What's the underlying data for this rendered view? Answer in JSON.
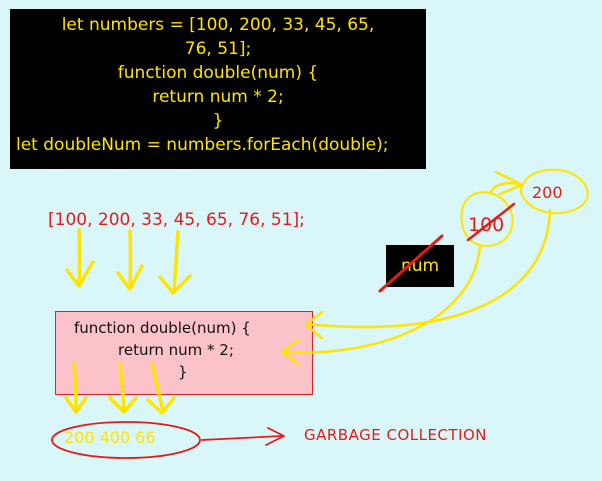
{
  "code": {
    "lines": [
      "let numbers = [100, 200, 33, 45, 65,",
      "76, 51];",
      "function double(num) {",
      "return num * 2;",
      "}",
      "let doubleNum = numbers.forEach(double);"
    ]
  },
  "array_label": "[100, 200, 33, 45, 65, 76, 51];",
  "param_label": "num",
  "function_box": {
    "lines": [
      "function double(num) {",
      "return num * 2;",
      "}"
    ]
  },
  "results_label": "200 400 66",
  "gc_label": "GARBAGE COLLECTION",
  "values": {
    "crossed": "100",
    "current": "200"
  },
  "colors": {
    "background": "#d9f6f8",
    "code_panel": "#000000",
    "code_text": "#ffe400",
    "red": "#e21b1b",
    "yellow": "#ffe400",
    "function_fill": "#fcc2ca"
  }
}
